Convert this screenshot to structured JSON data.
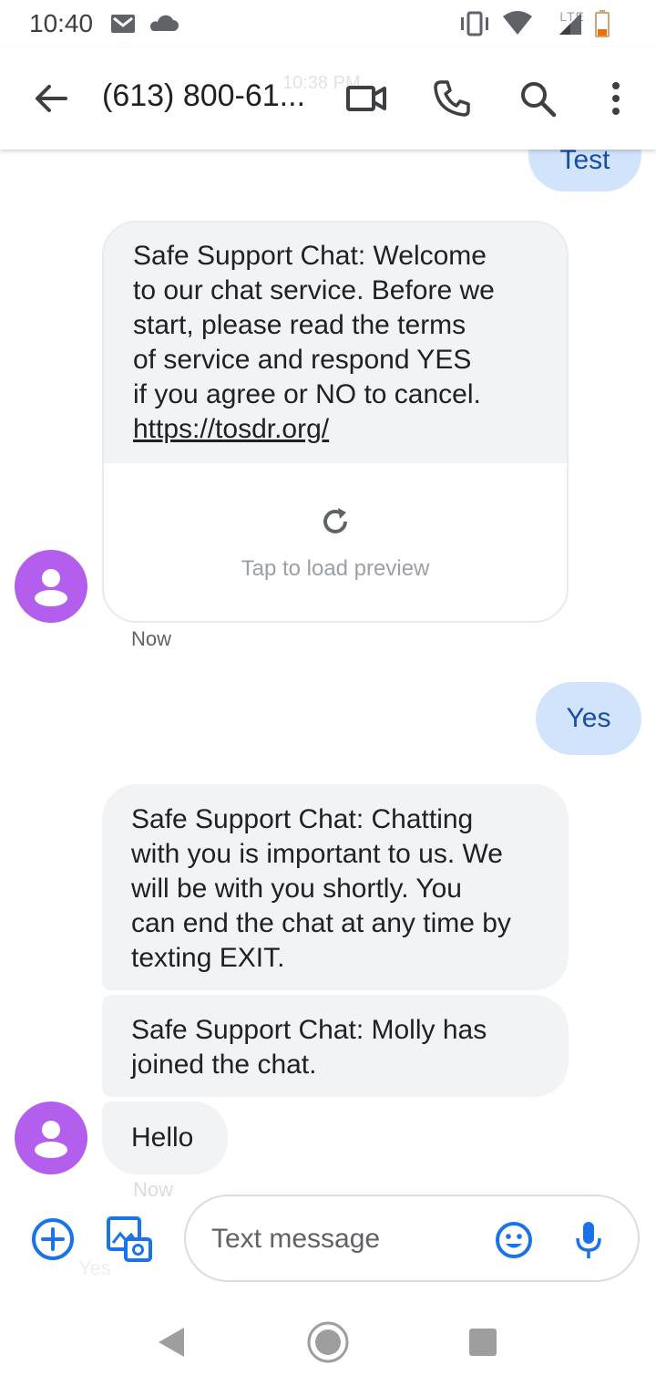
{
  "status_bar": {
    "time": "10:40",
    "network_label": "LTE",
    "icons": [
      "gmail-icon",
      "cloud-icon",
      "vibrate-icon",
      "wifi-icon",
      "signal-icon",
      "battery-low-icon"
    ],
    "battery_text": "11"
  },
  "header": {
    "title": "(613) 800-61...",
    "ghost_timestamp": "10:38 PM",
    "actions": [
      "video-call-icon",
      "phone-icon",
      "search-icon",
      "more-vert-icon"
    ]
  },
  "conversation": {
    "partial_top_outgoing": "Test",
    "message1": {
      "lines": [
        "Safe Support Chat: Welcome",
        "to our chat service. Before we",
        "start, please read the terms",
        "of service and respond YES",
        "if you agree or NO to cancel."
      ],
      "link": "https://tosdr.org/",
      "preview_label": "Tap to load preview",
      "timestamp": "Now"
    },
    "outgoing_yes": "Yes",
    "message2": {
      "lines": [
        "Safe Support Chat: Chatting",
        "with you is important to us. We",
        "will be with you shortly. You",
        "can end the chat at any time by",
        "texting EXIT."
      ]
    },
    "message3": {
      "lines": [
        "Safe Support Chat: Molly has",
        "joined the chat."
      ]
    },
    "message4": {
      "text": "Hello"
    },
    "ghost_now": "Now",
    "ghost_yes": "Yes"
  },
  "compose": {
    "placeholder": "Text message",
    "icons": [
      "add-icon",
      "gallery-icon",
      "emoji-icon",
      "mic-icon"
    ]
  },
  "colors": {
    "accent": "#1a73e8",
    "avatar": "#b45eee",
    "incoming_bubble": "#f1f3f4",
    "outgoing_bubble": "#d2e3fc"
  }
}
